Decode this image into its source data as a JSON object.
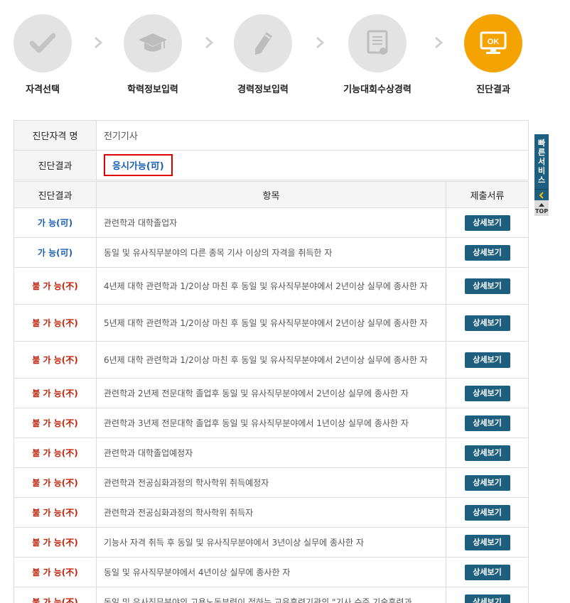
{
  "steps": [
    {
      "label": "자격선택",
      "icon": "check-icon",
      "active": false
    },
    {
      "label": "학력정보입력",
      "icon": "graduation-cap-icon",
      "active": false
    },
    {
      "label": "경력정보입력",
      "icon": "pencil-icon",
      "active": false
    },
    {
      "label": "기능대회수상경력",
      "icon": "certificate-icon",
      "active": false
    },
    {
      "label": "진단결과",
      "icon": "ok-monitor-icon",
      "active": true,
      "badge": "OK"
    }
  ],
  "info": {
    "qual_header": "진단자격 명",
    "qual_value": "전기기사",
    "result_header": "진단결과",
    "result_value": "응시가능(可)"
  },
  "table": {
    "headers": [
      "진단결과",
      "항목",
      "제출서류"
    ],
    "detail_label": "상세보기",
    "rows": [
      {
        "status": "가 능(可)",
        "ok": true,
        "item": "관련학과 대학졸업자"
      },
      {
        "status": "가 능(可)",
        "ok": true,
        "item": "동일 및 유사직무분야의 다른 종목 기사 이상의 자격을 취득한 자"
      },
      {
        "status": "불 가 능(不)",
        "ok": false,
        "item": "4년제 대학 관련학과 1/2이상 마친 후 동일 및 유사직무분야에서 2년이상 실무에 종사한 자"
      },
      {
        "status": "불 가 능(不)",
        "ok": false,
        "item": "5년제 대학 관련학과 1/2이상 마친 후 동일 및 유사직무분야에서 2년이상 실무에 종사한 자"
      },
      {
        "status": "불 가 능(不)",
        "ok": false,
        "item": "6년제 대학 관련학과 1/2이상 마친 후 동일 및 유사직무분야에서 2년이상 실무에 종사한 자"
      },
      {
        "status": "불 가 능(不)",
        "ok": false,
        "item": "관련학과 2년제 전문대학 졸업후 동일 및 유사직무분야에서 2년이상 실무에 종사한 자"
      },
      {
        "status": "불 가 능(不)",
        "ok": false,
        "item": "관련학과 3년제 전문대학 졸업후 동일 및 유사직무분야에서 1년이상 실무에 종사한 자"
      },
      {
        "status": "불 가 능(不)",
        "ok": false,
        "item": "관련학과 대학졸업예정자"
      },
      {
        "status": "불 가 능(不)",
        "ok": false,
        "item": "관련학과 전공심화과정의 학사학위 취득예정자"
      },
      {
        "status": "불 가 능(不)",
        "ok": false,
        "item": "관련학과 전공심화과정의 학사학위 취득자"
      },
      {
        "status": "불 가 능(不)",
        "ok": false,
        "item": "기능사 자격 취득 후 동일 및 유사직무분야에서 3년이상 실무에 종사한 자"
      },
      {
        "status": "불 가 능(不)",
        "ok": false,
        "item": "동일 및 유사직무분야에서 4년이상 실무에 종사한 자"
      },
      {
        "status": "불 가 능(不)",
        "ok": false,
        "item": "동일 및 유사직무분야의 고용노동부령이 정하는 교육훈련기관의 \"기사 수준 기술훈련과"
      }
    ]
  },
  "quick": {
    "label": "빠른서비스",
    "top_label": "TOP"
  },
  "colors": {
    "accent": "#f5a300",
    "button": "#1e5f7f",
    "possible": "#1a5fb4",
    "impossible": "#c0240a"
  }
}
